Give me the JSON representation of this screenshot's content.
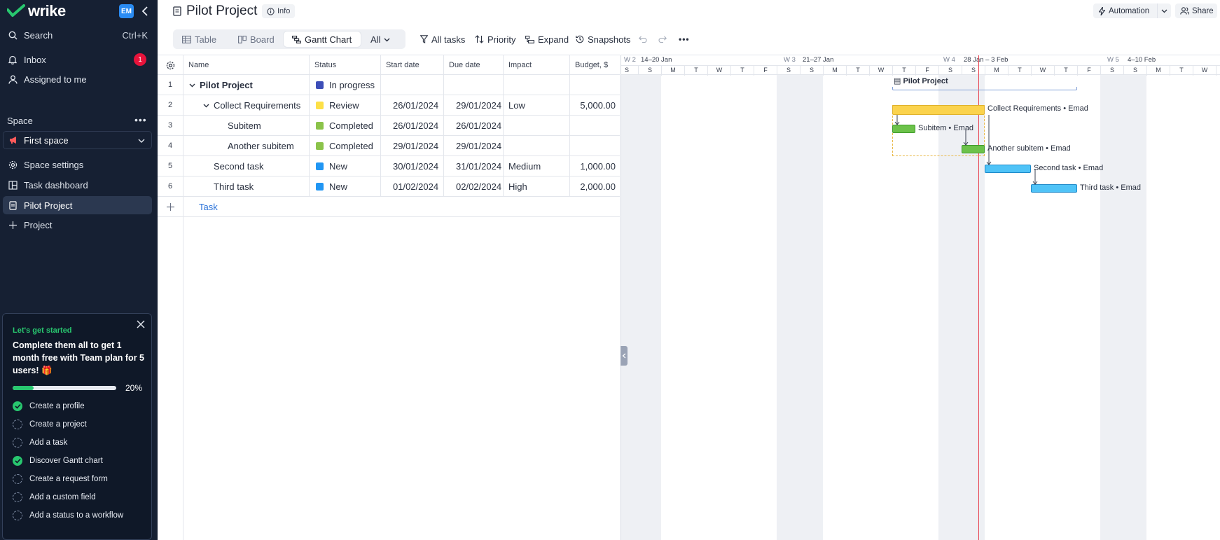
{
  "sidebar": {
    "logo_text": "wrike",
    "avatar_initials": "EM",
    "search_label": "Search",
    "search_shortcut": "Ctrl+K",
    "inbox_label": "Inbox",
    "inbox_count": "1",
    "assigned_label": "Assigned to me",
    "space_label": "Space",
    "space_more": "•••",
    "space_selected": "First space",
    "space_settings_label": "Space settings",
    "task_dashboard_label": "Task dashboard",
    "pilot_project_label": "Pilot Project",
    "project_label": "Project"
  },
  "onboarding": {
    "kicker": "Let's get started",
    "title": "Complete them all to get 1 month free with Team plan for 5 users! 🎁",
    "progress_percent": 20,
    "progress_label": "20%",
    "steps": [
      {
        "label": "Create a profile",
        "done": true
      },
      {
        "label": "Create a project",
        "done": false
      },
      {
        "label": "Add a task",
        "done": false
      },
      {
        "label": "Discover Gantt chart",
        "done": true
      },
      {
        "label": "Create a request form",
        "done": false
      },
      {
        "label": "Add a custom field",
        "done": false
      },
      {
        "label": "Add a status to a workflow",
        "done": false
      }
    ]
  },
  "header": {
    "title": "Pilot Project",
    "info_label": "Info",
    "automation_label": "Automation",
    "share_label": "Share"
  },
  "views": {
    "table_label": "Table",
    "board_label": "Board",
    "gantt_label": "Gantt Chart",
    "all_label": "All"
  },
  "toolbar": {
    "all_tasks_label": "All tasks",
    "priority_label": "Priority",
    "expand_label": "Expand",
    "snapshots_label": "Snapshots",
    "more_label": "•••"
  },
  "grid": {
    "columns": {
      "name": "Name",
      "status": "Status",
      "start": "Start date",
      "due": "Due date",
      "impact": "Impact",
      "budget": "Budget, $"
    },
    "rows": [
      {
        "num": "1",
        "name": "Pilot Project",
        "status": "In progress",
        "status_color": "#3d4eb8",
        "start": "",
        "due": "",
        "impact": "",
        "budget": ""
      },
      {
        "num": "2",
        "name": "Collect Requirements",
        "status": "Review",
        "status_color": "#fde047",
        "start": "26/01/2024",
        "due": "29/01/2024",
        "impact": "Low",
        "budget": "5,000.00"
      },
      {
        "num": "3",
        "name": "Subitem",
        "status": "Completed",
        "status_color": "#8bc34a",
        "start": "26/01/2024",
        "due": "26/01/2024",
        "impact": "",
        "budget": ""
      },
      {
        "num": "4",
        "name": "Another subitem",
        "status": "Completed",
        "status_color": "#8bc34a",
        "start": "29/01/2024",
        "due": "29/01/2024",
        "impact": "",
        "budget": ""
      },
      {
        "num": "5",
        "name": "Second task",
        "status": "New",
        "status_color": "#2196f3",
        "start": "30/01/2024",
        "due": "31/01/2024",
        "impact": "Medium",
        "budget": "1,000.00"
      },
      {
        "num": "6",
        "name": "Third task",
        "status": "New",
        "status_color": "#2196f3",
        "start": "01/02/2024",
        "due": "02/02/2024",
        "impact": "High",
        "budget": "2,000.00"
      }
    ],
    "add_task_label": "Task"
  },
  "gantt": {
    "weeks": [
      "W 2",
      "14–20 Jan",
      "W 3",
      "21–27 Jan",
      "W 4",
      "28 Jan – 3 Feb",
      "W 5",
      "4–10 Feb"
    ],
    "days": [
      "S",
      "S",
      "M",
      "T",
      "W",
      "T",
      "F",
      "S",
      "S",
      "M",
      "T",
      "W",
      "T",
      "F",
      "S",
      "S",
      "M",
      "T",
      "W",
      "T",
      "F",
      "S",
      "S",
      "M",
      "T",
      "W",
      "T"
    ],
    "bars": [
      {
        "label": "Pilot Project"
      },
      {
        "label": "Collect Requirements • Emad"
      },
      {
        "label": "Subitem • Emad"
      },
      {
        "label": "Another subitem • Emad"
      },
      {
        "label": "Second task • Emad"
      },
      {
        "label": "Third task • Emad"
      }
    ]
  }
}
